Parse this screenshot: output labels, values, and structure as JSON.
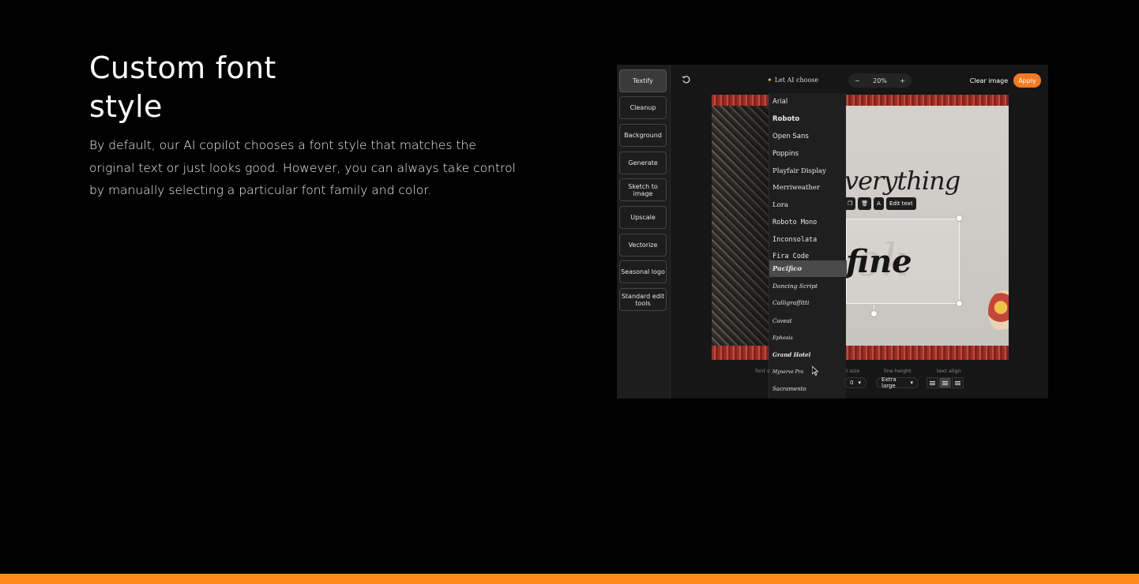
{
  "hero": {
    "title": "Custom font style",
    "description": "By default, our AI copilot chooses a font style that matches the original text or just looks good. However, you can always take control by manually selecting a particular font family and color."
  },
  "editor": {
    "sidebar": [
      "Textify",
      "Cleanup",
      "Background",
      "Generate",
      "Sketch to image",
      "Upscale",
      "Vectorize",
      "Seasonal logo",
      "Standard edit tools"
    ],
    "active_tool": "Textify",
    "font_select": "Let AI choose",
    "zoom": "20%",
    "zoom_minus": "−",
    "zoom_plus": "+",
    "clear_label": "Clear image",
    "apply_label": "Apply",
    "edit_text_label": "Edit text",
    "canvas_text_1": "verything",
    "canvas_text_3": "fine",
    "fonts": [
      "Arial",
      "Roboto",
      "Open Sans",
      "Poppins",
      "Playfair Display",
      "Merriweather",
      "Lora",
      "Roboto Mono",
      "Inconsolata",
      "Fira Code",
      "Pacifico",
      "Dancing Script",
      "Calligraffitti",
      "Caveat",
      "Ephesis",
      "Grand Hotel",
      "Mynerve Pro",
      "Sacramento"
    ],
    "selected_font": "Pacifico",
    "bottom": {
      "font_label": "font s",
      "size_label": "t size",
      "size_value": "0",
      "line_height_label": "line height",
      "line_height_value": "Extra large",
      "align_label": "text align"
    },
    "accent_color": "#f47a1f"
  },
  "colors": {
    "background": "#000000",
    "bottom_bar": "#ff8a1e"
  }
}
